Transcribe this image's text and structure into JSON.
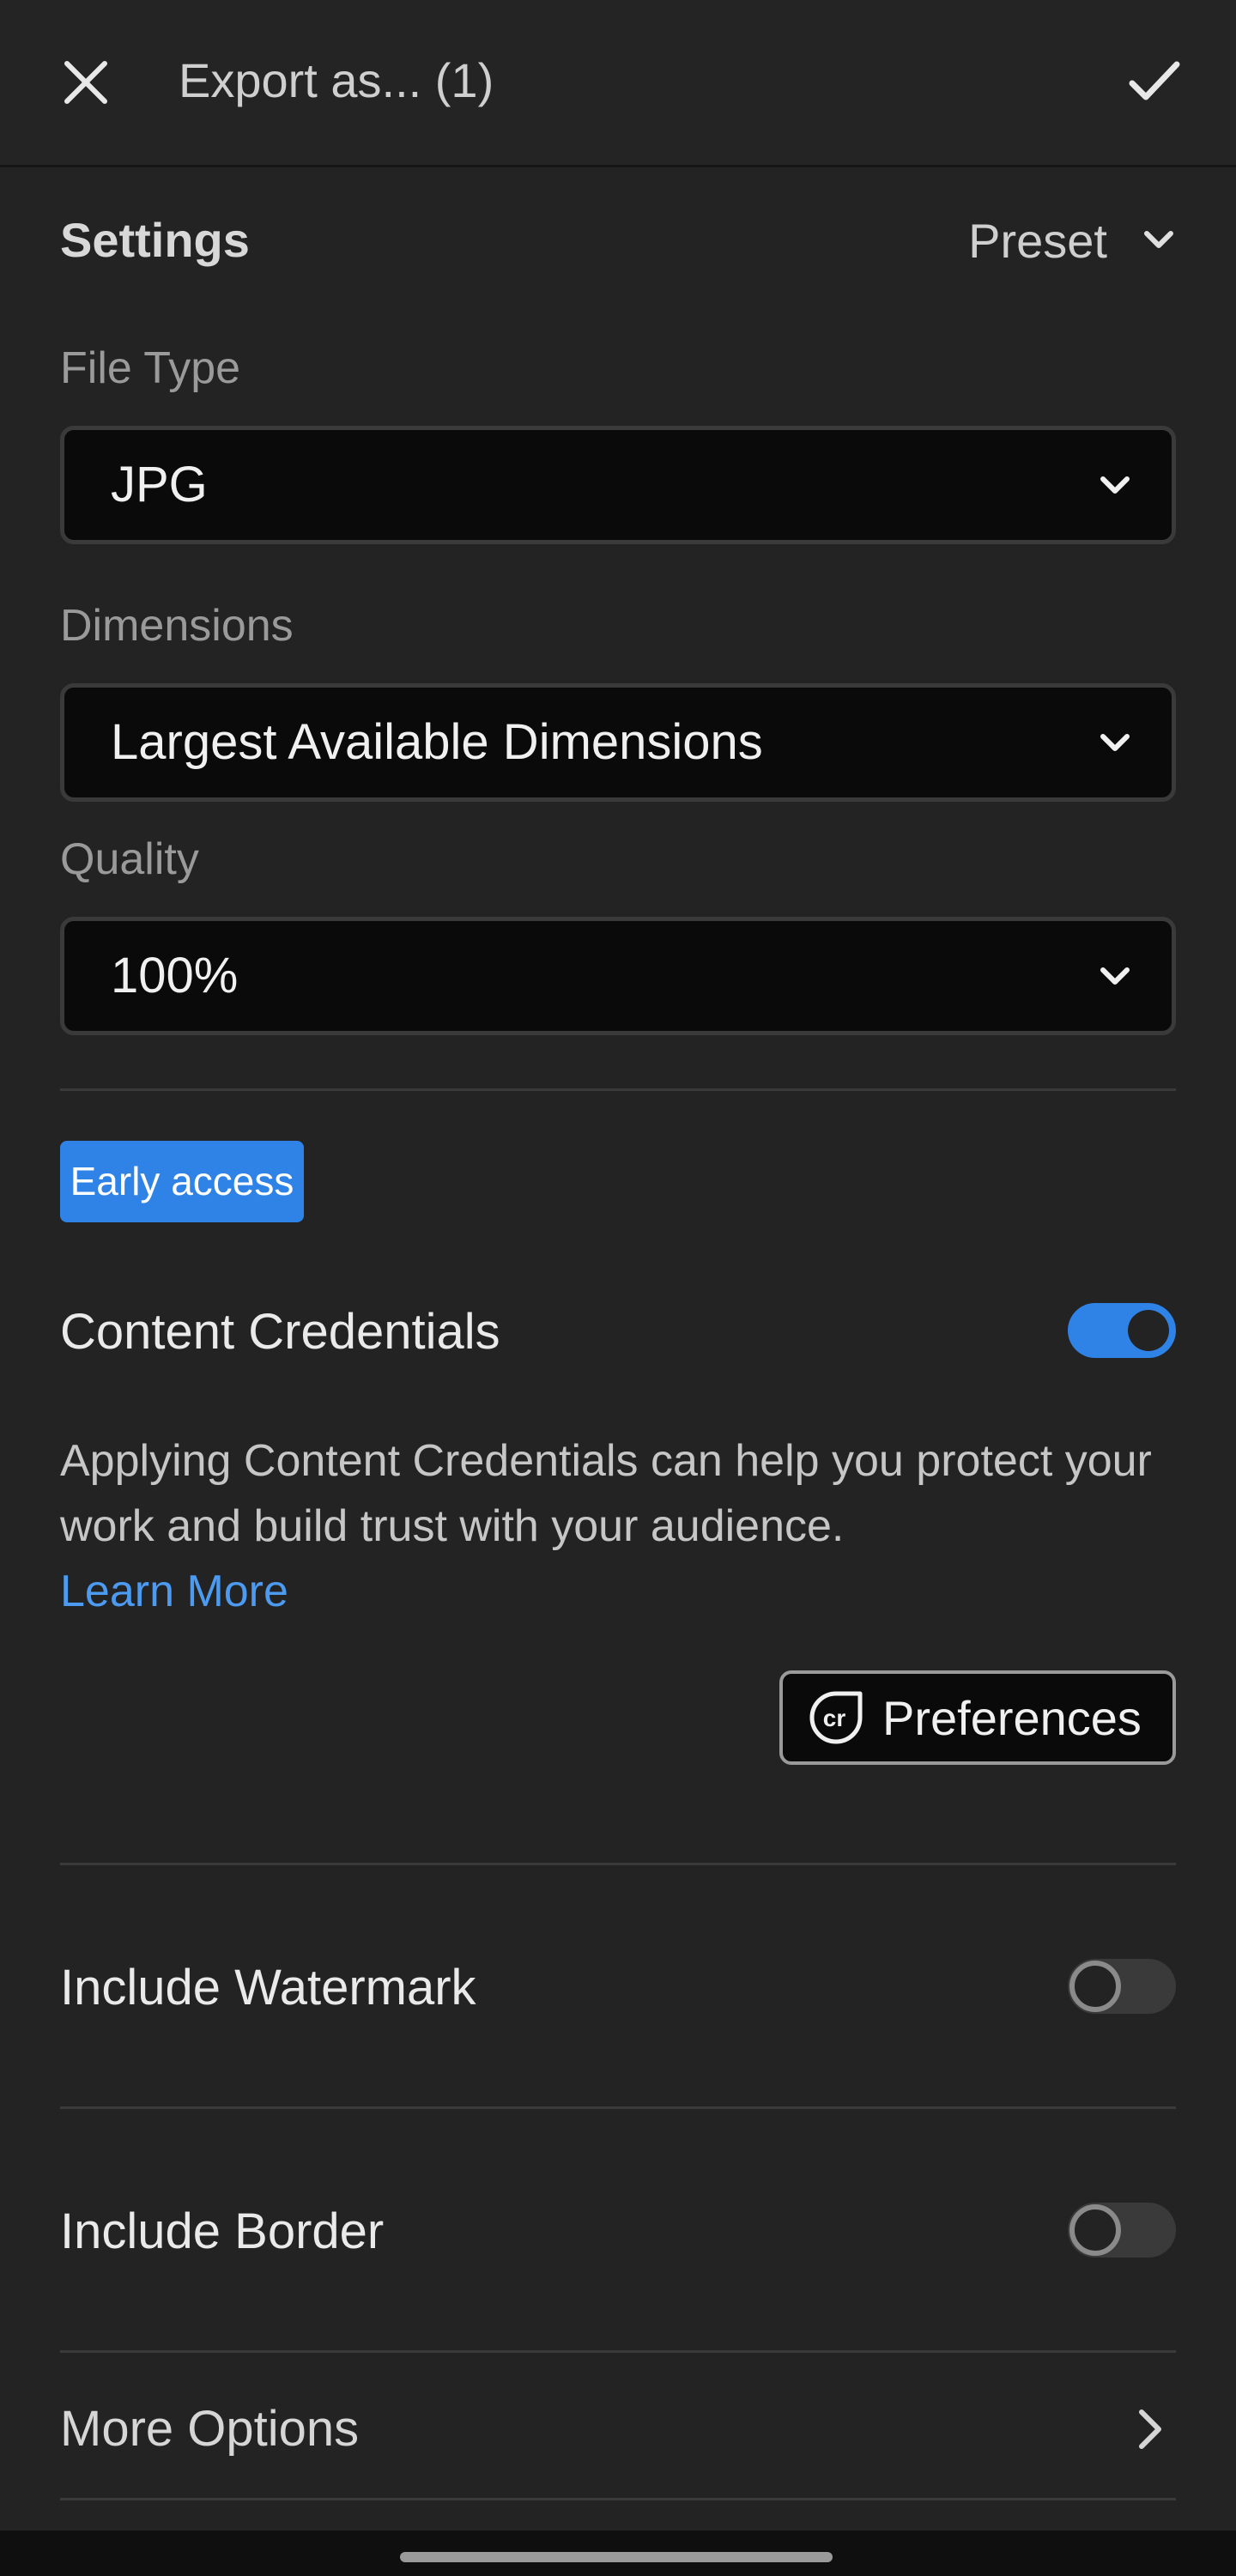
{
  "header": {
    "title": "Export as... (1)",
    "close_icon": "close-icon",
    "confirm_icon": "checkmark-icon"
  },
  "settings": {
    "title": "Settings",
    "preset_label": "Preset"
  },
  "file_type": {
    "label": "File Type",
    "value": "JPG"
  },
  "dimensions": {
    "label": "Dimensions",
    "value": "Largest Available Dimensions"
  },
  "quality": {
    "label": "Quality",
    "value": "100%"
  },
  "early_access": {
    "badge": "Early access"
  },
  "content_credentials": {
    "label": "Content Credentials",
    "enabled": true,
    "description": "Applying Content Credentials can help you protect your work and build trust with your audience.",
    "learn_more": "Learn More",
    "preferences_label": "Preferences",
    "preferences_icon_text": "cr"
  },
  "watermark": {
    "label": "Include Watermark",
    "enabled": false
  },
  "border": {
    "label": "Include Border",
    "enabled": false
  },
  "more_options": {
    "label": "More Options"
  },
  "colors": {
    "background": "#232323",
    "accent": "#2f83e6",
    "link": "#4c9bf0"
  }
}
